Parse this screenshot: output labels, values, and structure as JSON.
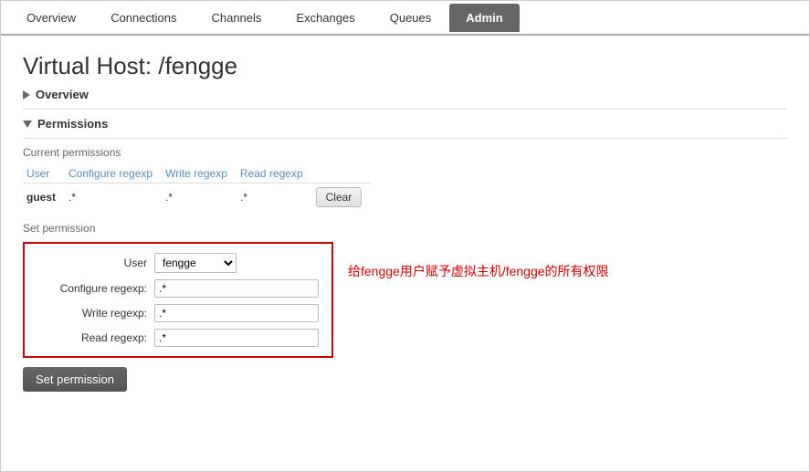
{
  "nav": {
    "tabs": [
      {
        "id": "overview",
        "label": "Overview",
        "active": false
      },
      {
        "id": "connections",
        "label": "Connections",
        "active": false
      },
      {
        "id": "channels",
        "label": "Channels",
        "active": false
      },
      {
        "id": "exchanges",
        "label": "Exchanges",
        "active": false
      },
      {
        "id": "queues",
        "label": "Queues",
        "active": false
      },
      {
        "id": "admin",
        "label": "Admin",
        "active": true
      }
    ]
  },
  "page": {
    "title": "Virtual Host: /fengge",
    "overview_label": "Overview",
    "permissions_label": "Permissions",
    "current_permissions_label": "Current permissions"
  },
  "permissions_table": {
    "headers": [
      "User",
      "Configure regexp",
      "Write regexp",
      "Read regexp"
    ],
    "rows": [
      {
        "user": "guest",
        "configure": ".*",
        "write": ".*",
        "read": ".*",
        "clear_label": "Clear"
      }
    ]
  },
  "set_permission": {
    "section_label": "Set permission",
    "user_label": "User",
    "user_value": "fengge",
    "user_options": [
      "fengge"
    ],
    "configure_label": "Configure regexp:",
    "configure_value": ".*",
    "write_label": "Write regexp:",
    "write_value": ".*",
    "read_label": "Read regexp:",
    "read_value": ".*",
    "button_label": "Set permission",
    "hint_text": "给fengge用户赋予虚拟主机/fengge的所有权限"
  }
}
